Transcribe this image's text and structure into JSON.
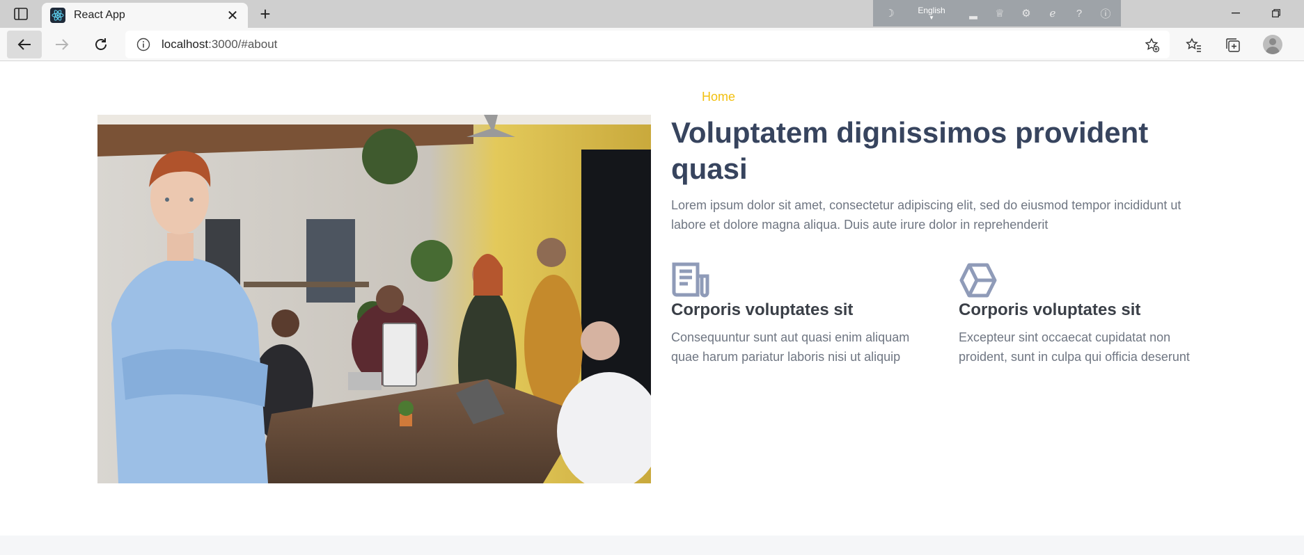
{
  "browser": {
    "tab_title": "React App",
    "url_host": "localhost",
    "url_rest": ":3000/#about",
    "extension_language": "English"
  },
  "page": {
    "nav": {
      "home_label": "Home"
    },
    "heading": "Voluptatem dignissimos provident quasi",
    "lead": "Lorem ipsum dolor sit amet, consectetur adipiscing elit, sed do eiusmod tempor incididunt ut labore et dolore magna aliqua. Duis aute irure dolor in reprehenderit",
    "features": [
      {
        "icon": "newspaper-icon",
        "title": "Corporis voluptates sit",
        "text": "Consequuntur sunt aut quasi enim aliquam quae harum pariatur laboris nisi ut aliquip"
      },
      {
        "icon": "cube-icon",
        "title": "Corporis voluptates sit",
        "text": "Excepteur sint occaecat cupidatat non proident, sunt in culpa qui officia deserunt"
      }
    ]
  },
  "colors": {
    "accent": "#f2c010",
    "heading": "#37445e",
    "body_text": "#6f7682",
    "icon": "#8f9bb8"
  }
}
